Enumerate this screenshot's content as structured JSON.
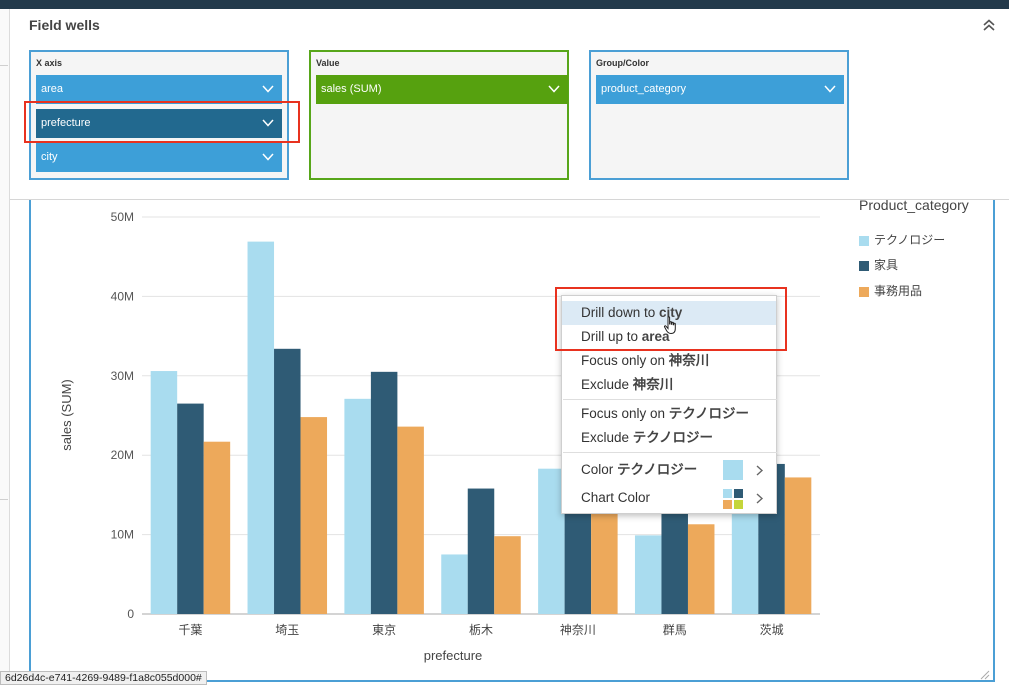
{
  "field_wells": {
    "title": "Field wells",
    "x_axis": {
      "label": "X axis",
      "fields": [
        "area",
        "prefecture",
        "city"
      ]
    },
    "value": {
      "label": "Value",
      "fields": [
        "sales (SUM)"
      ]
    },
    "group_color": {
      "label": "Group/Color",
      "fields": [
        "product_category"
      ]
    }
  },
  "legend": {
    "title": "Product_category",
    "items": [
      {
        "label": "テクノロジー",
        "color": "#a9dcef"
      },
      {
        "label": "家具",
        "color": "#2f5b75"
      },
      {
        "label": "事務用品",
        "color": "#eda95b"
      }
    ]
  },
  "context_menu": {
    "drill_down_prefix": "Drill down to ",
    "drill_down_target": "city",
    "drill_up_prefix": "Drill up to ",
    "drill_up_target": "area",
    "focus_prefix": "Focus only on ",
    "focus_target_1": "神奈川",
    "exclude_prefix": "Exclude ",
    "exclude_target_1": "神奈川",
    "focus_target_2": "テクノロジー",
    "exclude_target_2": "テクノロジー",
    "color_prefix": "Color ",
    "color_target": "テクノロジー",
    "chart_color_label": "Chart Color",
    "color_swatch": "#a9dcef",
    "chart_color_swatches": [
      "#a9dcef",
      "#2f5b75",
      "#eda95b",
      "#c5d53a"
    ]
  },
  "status_bar": {
    "text": "6d26d4c-e741-4269-9489-f1a8c055d000#"
  },
  "chart_data": {
    "type": "bar",
    "categories": [
      "千葉",
      "埼玉",
      "東京",
      "栃木",
      "神奈川",
      "群馬",
      "茨城"
    ],
    "series": [
      {
        "name": "テクノロジー",
        "values": [
          30.6,
          46.9,
          27.1,
          7.5,
          18.3,
          9.9,
          17.6
        ],
        "color": "#a9dcef"
      },
      {
        "name": "家具",
        "values": [
          26.5,
          33.4,
          30.5,
          15.8,
          18.6,
          14.7,
          18.9
        ],
        "color": "#2f5b75"
      },
      {
        "name": "事務用品",
        "values": [
          21.7,
          24.8,
          23.6,
          9.8,
          13.6,
          11.3,
          17.2
        ],
        "color": "#eda95b"
      }
    ],
    "xlabel": "prefecture",
    "ylabel": "sales (SUM)",
    "ylim": [
      0,
      50
    ],
    "yticks": [
      0,
      10,
      20,
      30,
      40,
      50
    ],
    "ytick_labels": [
      "0",
      "10M",
      "20M",
      "30M",
      "40M",
      "50M"
    ],
    "grid": true,
    "legend_position": "right"
  }
}
